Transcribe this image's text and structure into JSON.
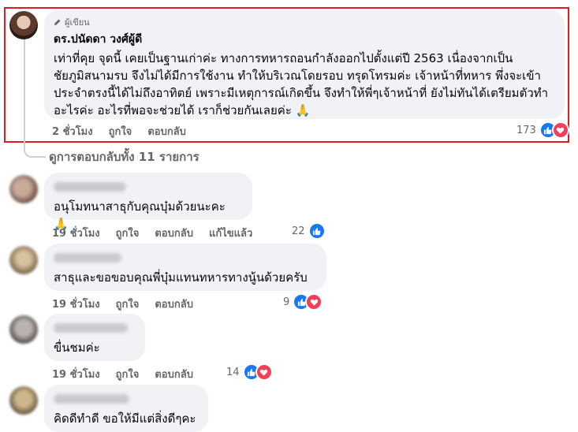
{
  "highlighted_comment": {
    "badge": "ผู้เขียน",
    "author": "ดร.ปนัดดา วงศ์ผู้ดี",
    "lines": [
      "เท่าที่คุย จุดนี้ เคยเป็นฐานเก่าค่ะ ทางการทหารถอนกำลังออกไปตั้งแต่ปี 2563 เนื่องจากเป็น",
      "ชัยภูมิสนามรบ จึงไม่ได้มีการใช้งาน ทำให้บริเวณโดยรอบ ทรุดโทรมค่ะ เจ้าหน้าที่ทหาร พึ่งจะเข้า",
      "ประจำตรงนี้ได้ไม่ถึงอาทิตย์ เพราะมีเหตุการณ์เกิดขึ้น จึงทำให้พี่ๆเจ้าหน้าที่ ยังไม่ทันได้เตรียมตัวทำ",
      "อะไรค่ะ อะไรที่พอจะช่วยได้ เราก็ช่วยกันเลยค่ะ 🙏"
    ],
    "time": "2 ชั่วโมง",
    "like": "ถูกใจ",
    "reply": "ตอบกลับ",
    "reaction_count": "173"
  },
  "view_replies": "ดูการตอบกลับทั้ง 11 รายการ",
  "comments": [
    {
      "text": "อนุโมทนาสาธุกับคุณบุ๋มด้วยนะคะ 🙏",
      "time": "19 ชั่วโมง",
      "like": "ถูกใจ",
      "reply": "ตอบกลับ",
      "edited": "แก้ไขแล้ว",
      "reaction_count": "22"
    },
    {
      "text": "สาธุและขอขอบคุณพี่บุ๋มแทนทหารทางนู้นด้วยครับ",
      "time": "19 ชั่วโมง",
      "like": "ถูกใจ",
      "reply": "ตอบกลับ",
      "reaction_count": "9"
    },
    {
      "text": "ขื่นชมค่ะ",
      "time": "19 ชั่วโมง",
      "like": "ถูกใจ",
      "reply": "ตอบกลับ",
      "reaction_count": "14"
    },
    {
      "text": "คิดดีทำดี ขอให้มีแต่สิ่งดีๆคะ"
    }
  ],
  "colors": {
    "highlight_border": "#e01b24",
    "bubble_bg": "#f0f2f5",
    "like_blue": "#1877f2",
    "love_red": "#f33e58",
    "meta_gray": "#65676b"
  },
  "icons": [
    "pencil-icon",
    "like-icon",
    "love-icon"
  ]
}
